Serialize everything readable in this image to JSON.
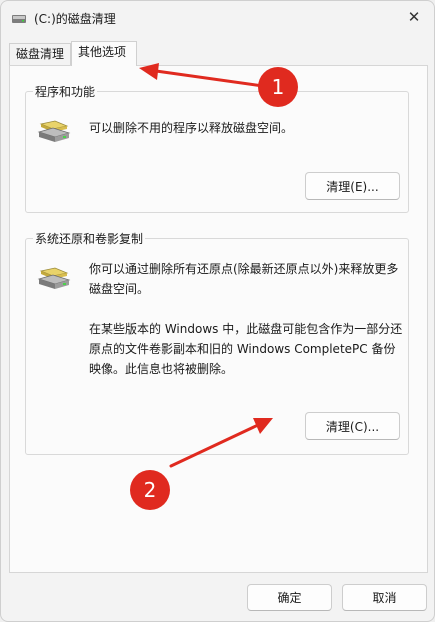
{
  "window": {
    "title": "(C:)的磁盘清理",
    "close_glyph": "✕"
  },
  "tabs": [
    {
      "label": "磁盘清理",
      "selected": false
    },
    {
      "label": "其他选项",
      "selected": true
    }
  ],
  "programs_group": {
    "legend": "程序和功能",
    "description": "可以删除不用的程序以释放磁盘空间。",
    "button_label": "清理(E)..."
  },
  "restore_group": {
    "legend": "系统还原和卷影复制",
    "description_lines": [
      "你可以通过删除所有还原点(除最新还原点以外)来释放更多",
      "磁盘空间。"
    ],
    "detail_lines": [
      "在某些版本的 Windows 中，此磁盘可能包含作为一部分还",
      "原点的文件卷影副本和旧的 Windows CompletePC 备份",
      "映像。此信息也将被删除。"
    ],
    "button_label": "清理(C)..."
  },
  "footer": {
    "ok_label": "确定",
    "cancel_label": "取消"
  },
  "annotations": [
    {
      "number": "1",
      "color": "#e02a1f"
    },
    {
      "number": "2",
      "color": "#e02a1f"
    }
  ],
  "colors": {
    "annotation_red": "#e02a1f"
  }
}
